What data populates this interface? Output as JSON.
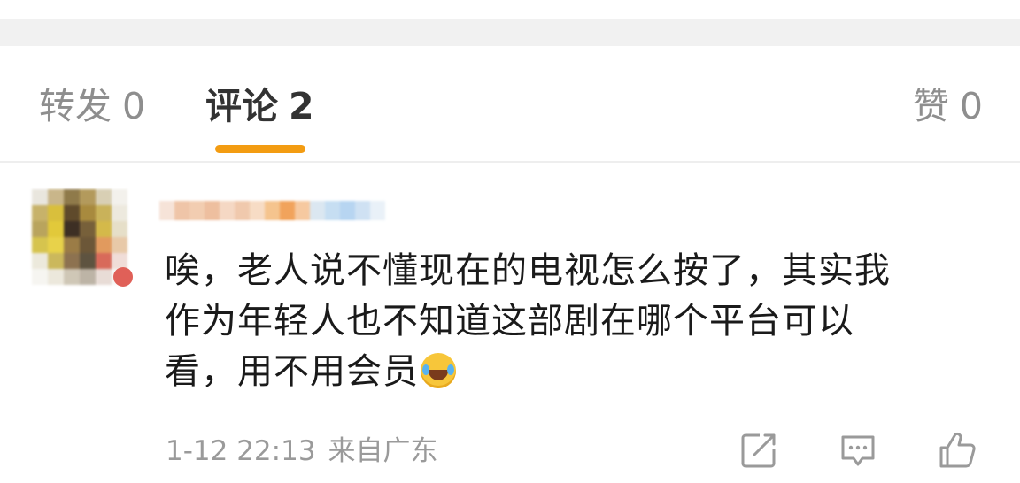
{
  "tabs": {
    "repost_label": "转发",
    "repost_count": "0",
    "comments_label": "评论",
    "comments_count": "2",
    "likes_label": "赞",
    "likes_count": "0",
    "active_tab": "comments",
    "indicator_color": "#f39c12"
  },
  "comment": {
    "avatar": "blurred-avatar",
    "username": "",
    "text_lines": [
      "唉，老人说不懂现在的电视怎么按了，其实我",
      "作为年轻人也不知道这部剧在哪个平台可以",
      "看，用不用会员"
    ],
    "emoji": "laughing-crying-emoji",
    "timestamp": "1-12 22:13",
    "location": "来自广东",
    "actions": [
      "repost-icon",
      "comment-icon",
      "like-icon"
    ]
  }
}
